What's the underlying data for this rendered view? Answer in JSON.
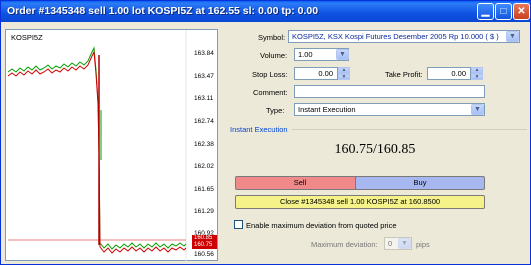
{
  "window": {
    "title": "Order #1345348 sell 1.00 lot KOSPI5Z at 162.55 sl: 0.00 tp: 0.00"
  },
  "chart": {
    "symbol": "KOSPI5Z",
    "price_labels": [
      "163.84",
      "163.47",
      "163.11",
      "162.74",
      "162.38",
      "162.02",
      "161.65",
      "161.29",
      "160.92",
      "160.56"
    ],
    "current_tags": [
      "160.85",
      "160.75"
    ],
    "tag_colors": {
      "ask": "#cc0000",
      "bid": "#cc0000"
    }
  },
  "form": {
    "symbol_label": "Symbol:",
    "symbol_value": "KOSPI5Z, KSX Kospi Futures Desember 2005 Rp 10.000 ( $ )",
    "volume_label": "Volume:",
    "volume_value": "1.00",
    "stop_loss_label": "Stop Loss:",
    "stop_loss_value": "0.00",
    "take_profit_label": "Take Profit:",
    "take_profit_value": "0.00",
    "comment_label": "Comment:",
    "comment_value": "",
    "type_label": "Type:",
    "type_value": "Instant Execution"
  },
  "execution": {
    "section_label": "Instant Execution",
    "quote": "160.75/160.85",
    "sell_label": "Sell",
    "buy_label": "Buy",
    "close_label": "Close #1345348 sell 1.00 KOSPI5Z at 160.8500",
    "deviation_check_label": "Enable maximum deviation from quoted price",
    "max_deviation_label": "Maximum deviation:",
    "max_deviation_value": "0",
    "pips_label": "pips"
  }
}
